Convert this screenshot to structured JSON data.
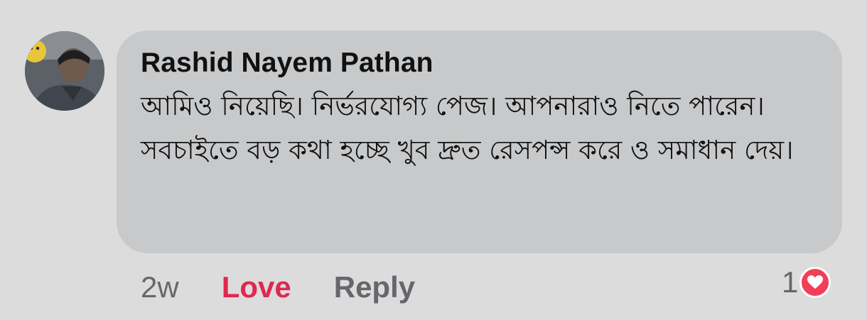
{
  "comment": {
    "author": "Rashid Nayem Pathan",
    "text": "আমিও নিয়েছি। নির্ভরযোগ্য পেজ। আপনারাও নিতে পারেন। সবচাইতে বড় কথা হচ্ছে খুব দ্রুত রেসপন্স করে ও সমাধান দেয়।",
    "timestamp": "2w",
    "love_label": "Love",
    "reply_label": "Reply",
    "reaction_count": "1",
    "reaction_icon": "heart-icon",
    "colors": {
      "love": "#e0284f",
      "reaction_heart": "#f33e58",
      "bubble": "#c8c9cb",
      "background": "#dcdcdd"
    }
  }
}
